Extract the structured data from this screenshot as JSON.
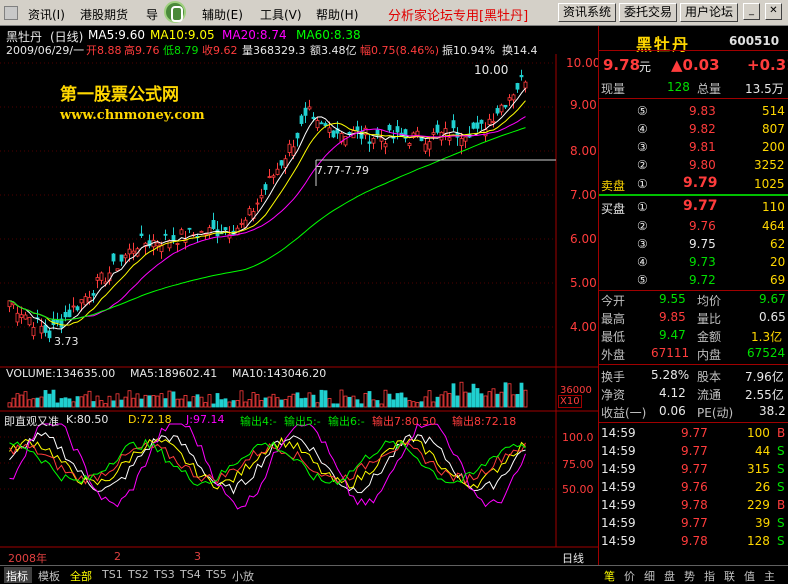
{
  "menubar": {
    "items": [
      "资讯(I)",
      "港股期货",
      "导",
      "辅助(E)",
      "工具(V)",
      "帮助(H)"
    ],
    "forum_label": "分析家论坛专用[黑牡丹]",
    "buttons": [
      "资讯系统",
      "委托交易",
      "用户论坛"
    ]
  },
  "chart": {
    "header_name": "黑牡丹",
    "header_period": "(日线)",
    "ma": [
      {
        "label": "MA5:9.60",
        "color": "#ffffff"
      },
      {
        "label": "MA10:9.05",
        "color": "#ffff00"
      },
      {
        "label": "MA20:8.74",
        "color": "#ff00ff"
      },
      {
        "label": "MA60:8.38",
        "color": "#00ff00"
      }
    ],
    "quote_line": {
      "date": "2009/06/29/一",
      "open": "开8.88",
      "high": "高9.76",
      "low": "低8.79",
      "amp_rate": "收9.62",
      "volume": "量368329.3",
      "amount": "额3.48亿",
      "change": "幅0.75(8.46%)",
      "swing": "振10.94%",
      "turnover": "换14.4"
    },
    "watermark_title": "第一股票公式网",
    "watermark_url": "www.chnmoney.com",
    "annot_high": "10.00",
    "annot_range": "7.77-7.79",
    "annot_low": "3.73",
    "y_axis": [
      "10.00",
      "9.00",
      "8.00",
      "7.00",
      "6.00",
      "5.00",
      "4.00"
    ],
    "volume_line": {
      "vol": "VOLUME:134635.00",
      "ma5": "MA5:189602.41",
      "ma10": "MA10:143046.20"
    },
    "vol_axis": "36000",
    "vol_scale": "X10",
    "kdj_line": {
      "name": "即直观又准",
      "k": "K:80.50",
      "d": "D:72.18",
      "j": "J:97.14",
      "o4": "输出4:-",
      "o5": "输出5:-",
      "o6": "输出6:-",
      "o7": "输出7:80.50",
      "o8": "输出8:72.18"
    },
    "kdj_axis": [
      "100.0",
      "75.00",
      "50.00"
    ],
    "x_labels": [
      "2008年",
      "2",
      "3"
    ],
    "period_label": "日线"
  },
  "panel": {
    "name": "黑牡丹",
    "code": "600510",
    "price": "9.78",
    "price_unit": "元",
    "change": "▲0.03",
    "change_pct": "+0.31",
    "volume_label": "现量",
    "volume_val": "128",
    "total_label": "总量",
    "total_val": "13.5万",
    "sell_label": "卖盘",
    "buy_label": "买盘",
    "asks": [
      {
        "num": "⑤",
        "price": "9.83",
        "vol": "514"
      },
      {
        "num": "④",
        "price": "9.82",
        "vol": "807"
      },
      {
        "num": "③",
        "price": "9.81",
        "vol": "200"
      },
      {
        "num": "②",
        "price": "9.80",
        "vol": "3252"
      },
      {
        "num": "①",
        "price": "9.79",
        "vol": "1025"
      }
    ],
    "bids": [
      {
        "num": "①",
        "price": "9.77",
        "vol": "110"
      },
      {
        "num": "②",
        "price": "9.76",
        "vol": "464"
      },
      {
        "num": "③",
        "price": "9.75",
        "vol": "62"
      },
      {
        "num": "④",
        "price": "9.73",
        "vol": "20"
      },
      {
        "num": "⑤",
        "price": "9.72",
        "vol": "69"
      }
    ],
    "stats": [
      {
        "l1": "今开",
        "v1": "9.55",
        "l2": "均价",
        "v2": "9.67"
      },
      {
        "l1": "最高",
        "v1": "9.85",
        "l2": "量比",
        "v2": "0.65"
      },
      {
        "l1": "最低",
        "v1": "9.47",
        "l2": "金额",
        "v2": "1.3亿"
      },
      {
        "l1": "外盘",
        "v1": "67111",
        "l2": "内盘",
        "v2": "67524"
      }
    ],
    "fund": [
      {
        "l1": "换手",
        "v1": "5.28%",
        "l2": "股本",
        "v2": "7.96亿"
      },
      {
        "l1": "净资",
        "v1": "4.12",
        "l2": "流通",
        "v2": "2.55亿"
      },
      {
        "l1": "收益(一)",
        "v1": "0.06",
        "l2": "PE(动)",
        "v2": "38.2"
      }
    ],
    "ticks": [
      {
        "time": "14:59",
        "price": "9.77",
        "vol": "100",
        "side": "B"
      },
      {
        "time": "14:59",
        "price": "9.77",
        "vol": "44",
        "side": "S"
      },
      {
        "time": "14:59",
        "price": "9.77",
        "vol": "315",
        "side": "S"
      },
      {
        "time": "14:59",
        "price": "9.76",
        "vol": "26",
        "side": "S"
      },
      {
        "time": "14:59",
        "price": "9.78",
        "vol": "229",
        "side": "B"
      },
      {
        "time": "14:59",
        "price": "9.77",
        "vol": "39",
        "side": "S"
      },
      {
        "time": "14:59",
        "price": "9.78",
        "vol": "128",
        "side": "S"
      }
    ]
  },
  "tabs": {
    "left": [
      "指标",
      "模板",
      "全部",
      "TS1",
      "TS2",
      "TS3",
      "TS4",
      "TS5",
      "小放"
    ],
    "right": [
      "笔",
      "价",
      "细",
      "盘",
      "势",
      "指",
      "联",
      "值",
      "主"
    ]
  }
}
